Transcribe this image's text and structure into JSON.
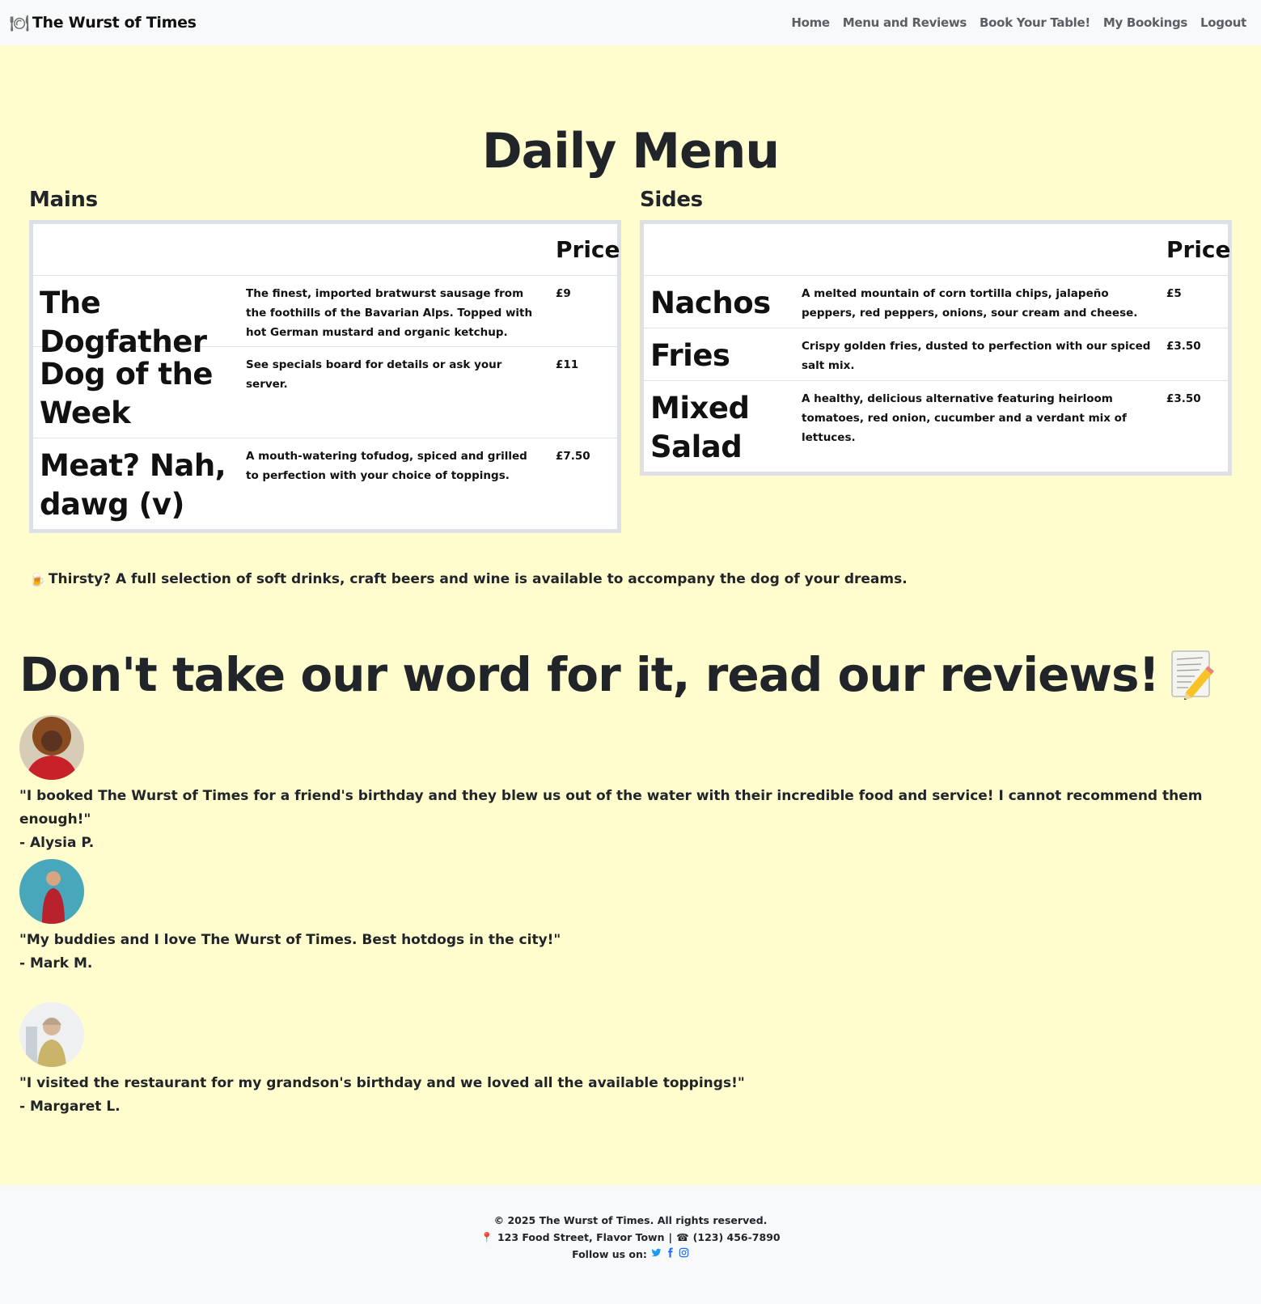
{
  "navbar": {
    "brand": "The Wurst of Times",
    "links": [
      "Home",
      "Menu and Reviews",
      "Book Your Table!",
      "My Bookings",
      "Logout"
    ]
  },
  "menu": {
    "title": "Daily Menu",
    "mains": {
      "heading": "Mains",
      "price_header": "Price",
      "items": [
        {
          "name": "The Dogfather",
          "desc": "The finest, imported bratwurst sausage from the foothills of the Bavarian Alps. Topped with hot German mustard and organic ketchup.",
          "price": "£9"
        },
        {
          "name": "Dog of the Week",
          "desc": "See specials board for details or ask your server.",
          "price": "£11"
        },
        {
          "name": "Meat? Nah, dawg (v)",
          "desc": "A mouth-watering tofudog, spiced and grilled to perfection with your choice of toppings.",
          "price": "£7.50"
        }
      ]
    },
    "sides": {
      "heading": "Sides",
      "price_header": "Price",
      "items": [
        {
          "name": "Nachos",
          "desc": "A melted mountain of corn tortilla chips, jalapeño peppers, red peppers, onions, sour cream and cheese.",
          "price": "£5"
        },
        {
          "name": "Fries",
          "desc": "Crispy golden fries, dusted to perfection with our spiced salt mix.",
          "price": "£3.50"
        },
        {
          "name": "Mixed Salad",
          "desc": "A healthy, delicious alternative featuring heirloom tomatoes, red onion, cucumber and a verdant mix of lettuces.",
          "price": "£3.50"
        }
      ]
    },
    "thirsty": "Thirsty? A full selection of soft drinks, craft beers and wine is available to accompany the dog of your dreams."
  },
  "reviews": {
    "title": "Don't take our word for it, read our reviews!",
    "items": [
      {
        "quote": "\"I booked The Wurst of Times for a friend's birthday and they blew us out of the water with their incredible food and service! I cannot recommend them enough!\"",
        "author": "- Alysia P."
      },
      {
        "quote": "\"My buddies and I love The Wurst of Times. Best hotdogs in the city!\"",
        "author": "- Mark M."
      },
      {
        "quote": "\"I visited the restaurant for my grandson's birthday and we loved all the available toppings!\"",
        "author": "- Margaret L."
      }
    ]
  },
  "footer": {
    "copyright": "© 2025 The Wurst of Times. All rights reserved.",
    "address": "123 Food Street, Flavor Town",
    "separator": "|",
    "phone": "(123) 456-7890",
    "follow": "Follow us on:"
  },
  "colors": {
    "page_bg": "#fffdcd",
    "nav_bg": "#f8f9fa",
    "table_border": "#dde1e6",
    "social_blue": "#1d9bf0"
  },
  "icons": [
    "plate-cutlery-icon",
    "beer-mug-icon",
    "memo-pencil-icon",
    "map-pin-icon",
    "phone-icon",
    "twitter-icon",
    "facebook-icon",
    "instagram-icon"
  ]
}
